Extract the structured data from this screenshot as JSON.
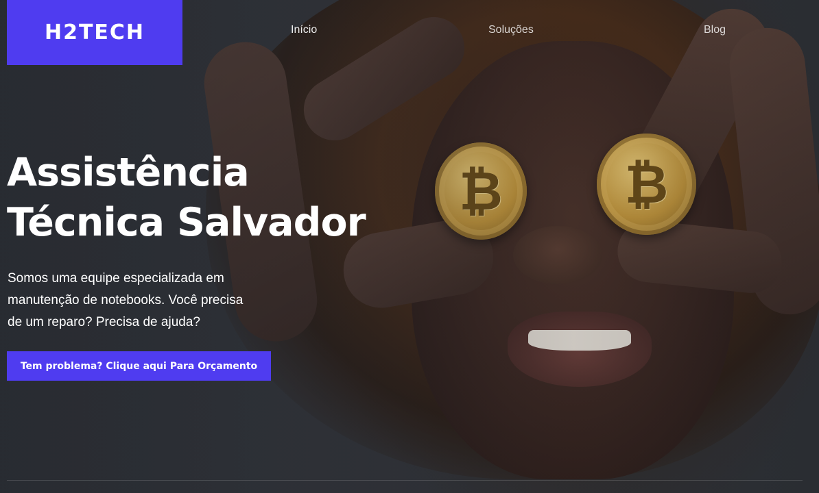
{
  "header": {
    "logo_text": "H2TECH",
    "nav": [
      {
        "label": "Início"
      },
      {
        "label": "Soluções"
      },
      {
        "label": "Blog"
      }
    ]
  },
  "hero": {
    "title_line1": "Assistência",
    "title_line2": "Técnica Salvador",
    "subtitle": "Somos uma equipe especializada em manutenção de notebooks. Você precisa de um reparo? Precisa de ajuda?",
    "cta_label": "Tem problema? Clique aqui Para Orçamento",
    "background_image": "woman-holding-bitcoin-coins-over-eyes"
  },
  "colors": {
    "accent": "#4f3cf0",
    "text": "#ffffff",
    "background": "#2b2e33"
  },
  "icons": {
    "coin_symbol": "₿"
  }
}
